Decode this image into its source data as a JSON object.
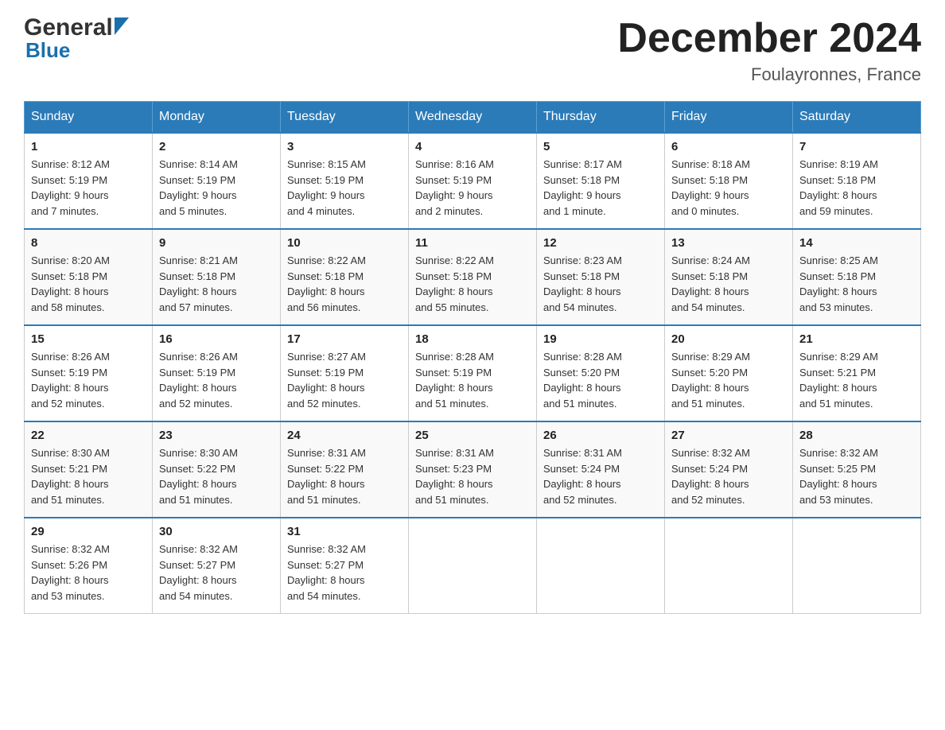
{
  "header": {
    "logo_general": "General",
    "logo_blue": "Blue",
    "title": "December 2024",
    "subtitle": "Foulayronnes, France"
  },
  "days_of_week": [
    "Sunday",
    "Monday",
    "Tuesday",
    "Wednesday",
    "Thursday",
    "Friday",
    "Saturday"
  ],
  "weeks": [
    [
      {
        "day": "1",
        "sunrise": "8:12 AM",
        "sunset": "5:19 PM",
        "daylight": "9 hours and 7 minutes."
      },
      {
        "day": "2",
        "sunrise": "8:14 AM",
        "sunset": "5:19 PM",
        "daylight": "9 hours and 5 minutes."
      },
      {
        "day": "3",
        "sunrise": "8:15 AM",
        "sunset": "5:19 PM",
        "daylight": "9 hours and 4 minutes."
      },
      {
        "day": "4",
        "sunrise": "8:16 AM",
        "sunset": "5:19 PM",
        "daylight": "9 hours and 2 minutes."
      },
      {
        "day": "5",
        "sunrise": "8:17 AM",
        "sunset": "5:18 PM",
        "daylight": "9 hours and 1 minute."
      },
      {
        "day": "6",
        "sunrise": "8:18 AM",
        "sunset": "5:18 PM",
        "daylight": "9 hours and 0 minutes."
      },
      {
        "day": "7",
        "sunrise": "8:19 AM",
        "sunset": "5:18 PM",
        "daylight": "8 hours and 59 minutes."
      }
    ],
    [
      {
        "day": "8",
        "sunrise": "8:20 AM",
        "sunset": "5:18 PM",
        "daylight": "8 hours and 58 minutes."
      },
      {
        "day": "9",
        "sunrise": "8:21 AM",
        "sunset": "5:18 PM",
        "daylight": "8 hours and 57 minutes."
      },
      {
        "day": "10",
        "sunrise": "8:22 AM",
        "sunset": "5:18 PM",
        "daylight": "8 hours and 56 minutes."
      },
      {
        "day": "11",
        "sunrise": "8:22 AM",
        "sunset": "5:18 PM",
        "daylight": "8 hours and 55 minutes."
      },
      {
        "day": "12",
        "sunrise": "8:23 AM",
        "sunset": "5:18 PM",
        "daylight": "8 hours and 54 minutes."
      },
      {
        "day": "13",
        "sunrise": "8:24 AM",
        "sunset": "5:18 PM",
        "daylight": "8 hours and 54 minutes."
      },
      {
        "day": "14",
        "sunrise": "8:25 AM",
        "sunset": "5:18 PM",
        "daylight": "8 hours and 53 minutes."
      }
    ],
    [
      {
        "day": "15",
        "sunrise": "8:26 AM",
        "sunset": "5:19 PM",
        "daylight": "8 hours and 52 minutes."
      },
      {
        "day": "16",
        "sunrise": "8:26 AM",
        "sunset": "5:19 PM",
        "daylight": "8 hours and 52 minutes."
      },
      {
        "day": "17",
        "sunrise": "8:27 AM",
        "sunset": "5:19 PM",
        "daylight": "8 hours and 52 minutes."
      },
      {
        "day": "18",
        "sunrise": "8:28 AM",
        "sunset": "5:19 PM",
        "daylight": "8 hours and 51 minutes."
      },
      {
        "day": "19",
        "sunrise": "8:28 AM",
        "sunset": "5:20 PM",
        "daylight": "8 hours and 51 minutes."
      },
      {
        "day": "20",
        "sunrise": "8:29 AM",
        "sunset": "5:20 PM",
        "daylight": "8 hours and 51 minutes."
      },
      {
        "day": "21",
        "sunrise": "8:29 AM",
        "sunset": "5:21 PM",
        "daylight": "8 hours and 51 minutes."
      }
    ],
    [
      {
        "day": "22",
        "sunrise": "8:30 AM",
        "sunset": "5:21 PM",
        "daylight": "8 hours and 51 minutes."
      },
      {
        "day": "23",
        "sunrise": "8:30 AM",
        "sunset": "5:22 PM",
        "daylight": "8 hours and 51 minutes."
      },
      {
        "day": "24",
        "sunrise": "8:31 AM",
        "sunset": "5:22 PM",
        "daylight": "8 hours and 51 minutes."
      },
      {
        "day": "25",
        "sunrise": "8:31 AM",
        "sunset": "5:23 PM",
        "daylight": "8 hours and 51 minutes."
      },
      {
        "day": "26",
        "sunrise": "8:31 AM",
        "sunset": "5:24 PM",
        "daylight": "8 hours and 52 minutes."
      },
      {
        "day": "27",
        "sunrise": "8:32 AM",
        "sunset": "5:24 PM",
        "daylight": "8 hours and 52 minutes."
      },
      {
        "day": "28",
        "sunrise": "8:32 AM",
        "sunset": "5:25 PM",
        "daylight": "8 hours and 53 minutes."
      }
    ],
    [
      {
        "day": "29",
        "sunrise": "8:32 AM",
        "sunset": "5:26 PM",
        "daylight": "8 hours and 53 minutes."
      },
      {
        "day": "30",
        "sunrise": "8:32 AM",
        "sunset": "5:27 PM",
        "daylight": "8 hours and 54 minutes."
      },
      {
        "day": "31",
        "sunrise": "8:32 AM",
        "sunset": "5:27 PM",
        "daylight": "8 hours and 54 minutes."
      },
      null,
      null,
      null,
      null
    ]
  ],
  "labels": {
    "sunrise": "Sunrise:",
    "sunset": "Sunset:",
    "daylight": "Daylight:"
  }
}
